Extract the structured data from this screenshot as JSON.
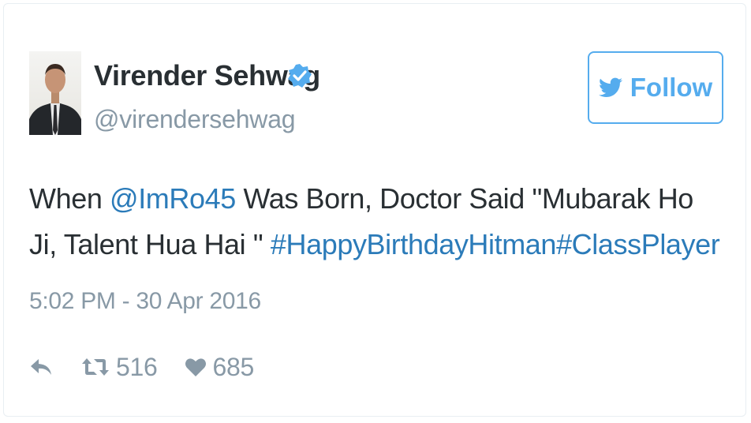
{
  "tweet": {
    "author": {
      "name": "Virender Sehwag",
      "handle": "@virendersehwag",
      "verified": true
    },
    "follow_label": "Follow",
    "text": {
      "part1": "When ",
      "mention": "@ImRo45",
      "part2": " Was Born, Doctor Said \"Mubarak Ho Ji, Talent Hua Hai \" ",
      "hashtag1": "#HappyBirthdayHitman",
      "hashtag2": "#ClassPlayer"
    },
    "timestamp": "5:02 PM - 30 Apr 2016",
    "retweet_count": "516",
    "like_count": "685"
  },
  "icons": {
    "verified": "verified-badge-icon",
    "follow": "twitter-bird-icon",
    "reply": "reply-icon",
    "retweet": "retweet-icon",
    "like": "heart-icon"
  },
  "colors": {
    "brand_blue": "#55acee",
    "link_blue": "#2b7bb9",
    "text_dark": "#292f33",
    "text_muted": "#8899a6"
  }
}
